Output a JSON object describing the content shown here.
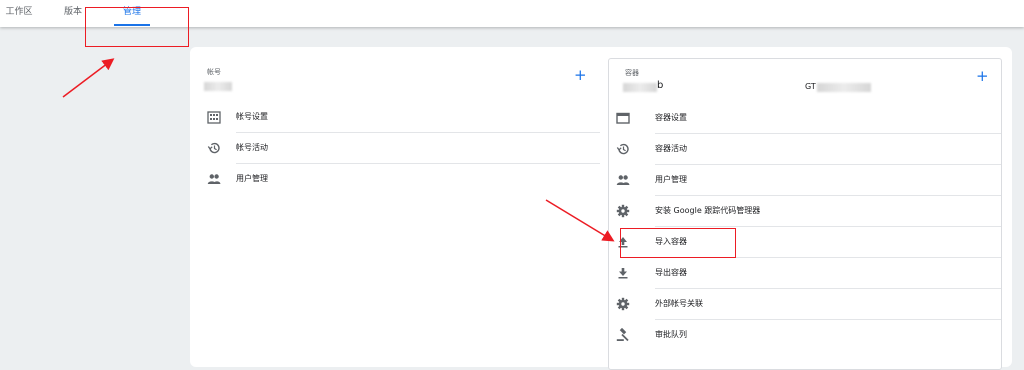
{
  "tabs": [
    {
      "label": "工作区"
    },
    {
      "label": "版本"
    },
    {
      "label": "管理"
    }
  ],
  "account": {
    "label": "帐号",
    "add_button": "+",
    "items": [
      {
        "label": "帐号设置",
        "icon": "building-icon"
      },
      {
        "label": "帐号活动",
        "icon": "history-icon"
      },
      {
        "label": "用户管理",
        "icon": "people-icon"
      }
    ]
  },
  "container": {
    "label": "容器",
    "name_suffix": "b",
    "id_prefix": "GT",
    "add_button": "+",
    "items": [
      {
        "label": "容器设置",
        "icon": "browser-window-icon"
      },
      {
        "label": "容器活动",
        "icon": "history-icon"
      },
      {
        "label": "用户管理",
        "icon": "people-icon"
      },
      {
        "label": "安装 Google 跟踪代码管理器",
        "icon": "gear-icon"
      },
      {
        "label": "导入容器",
        "icon": "upload-icon"
      },
      {
        "label": "导出容器",
        "icon": "download-icon"
      },
      {
        "label": "外部帐号关联",
        "icon": "gear-icon"
      },
      {
        "label": "审批队列",
        "icon": "gavel-icon"
      }
    ]
  },
  "colors": {
    "accent": "#1a73e8",
    "annotation": "#ec1c24"
  }
}
